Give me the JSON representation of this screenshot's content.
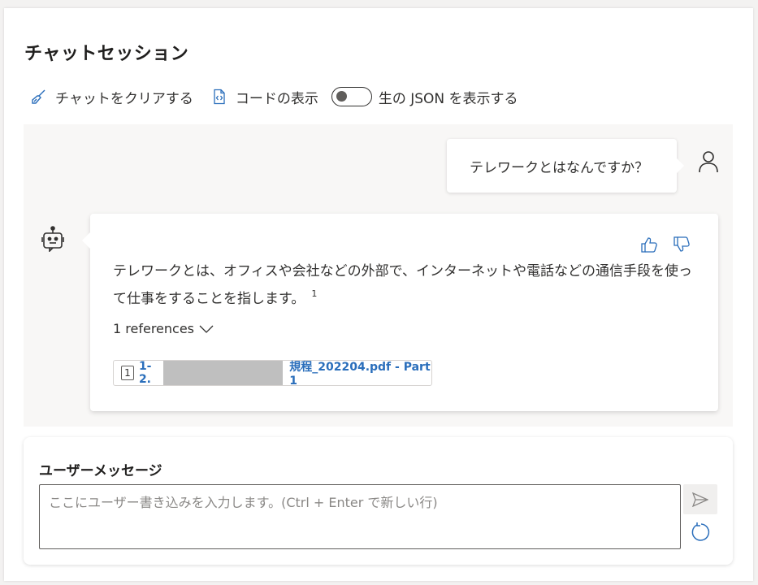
{
  "session": {
    "title": "チャットセッション"
  },
  "toolbar": {
    "clear_label": "チャットをクリアする",
    "code_label": "コードの表示",
    "json_toggle_label": "生の JSON を表示する",
    "json_toggle_on": false
  },
  "messages": {
    "user": {
      "text": "テレワークとはなんですか？"
    },
    "assistant": {
      "text": "テレワークとは、オフィスや会社などの外部で、インターネットや電話などの通信手段を使って仕事をすることを指します。",
      "citation": "1",
      "references_label": "1 references",
      "reference": {
        "number": "1",
        "prefix": "1-2.",
        "suffix": "規程_202204.pdf - Part 1"
      }
    }
  },
  "input": {
    "label": "ユーザーメッセージ",
    "placeholder": "ここにユーザー書き込みを入力します。(Ctrl + Enter で新しい行)",
    "value": ""
  },
  "colors": {
    "accent": "#2a6ebb",
    "chat_bg": "#f8f7f6"
  },
  "icons": {
    "clear": "broom-icon",
    "code": "code-file-icon",
    "user": "person-icon",
    "bot": "bot-icon",
    "like": "thumbs-up-icon",
    "dislike": "thumbs-down-icon",
    "send": "send-icon",
    "reset": "refresh-icon",
    "expand": "chevron-down-icon"
  }
}
